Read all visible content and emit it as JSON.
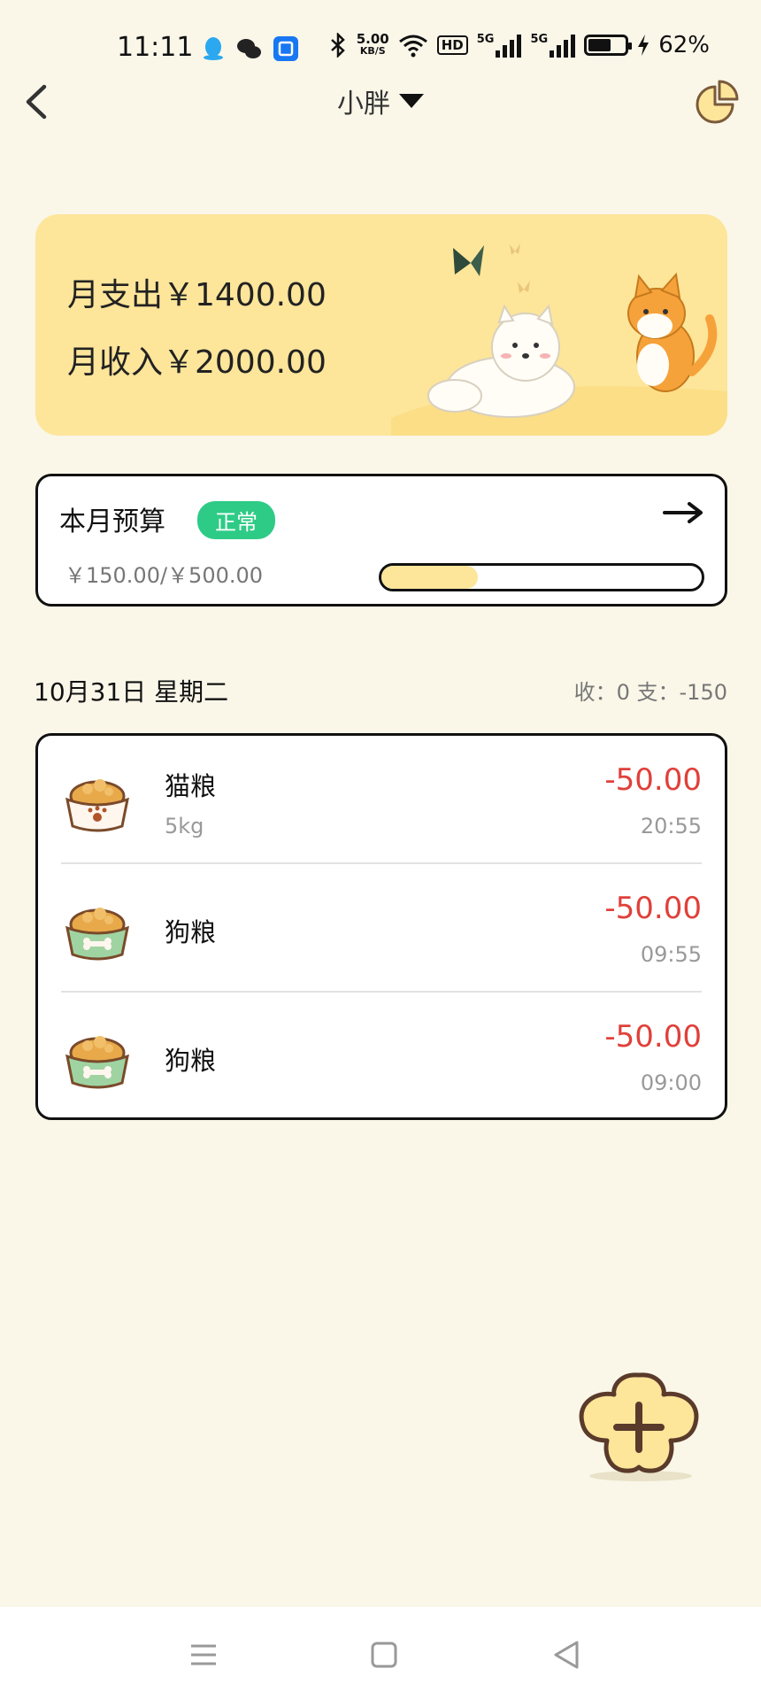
{
  "status_bar": {
    "time": "11:11",
    "net_speed": "5.00",
    "net_unit": "KB/S",
    "hd": "HD",
    "signal1": "5G",
    "signal2": "5G",
    "battery": "62%",
    "battery_level": 0.62
  },
  "header": {
    "title": "小胖"
  },
  "summary": {
    "expense_line": "月支出￥1400.00",
    "income_line": "月收入￥2000.00"
  },
  "budget": {
    "title": "本月预算",
    "status": "正常",
    "amount": "￥150.00/￥500.00",
    "progress": 0.3
  },
  "day": {
    "date": "10月31日 星期二",
    "summary": "收：0 支：-150"
  },
  "records": [
    {
      "name": "猫粮",
      "note": "5kg",
      "amount": "-50.00",
      "time": "20:55",
      "icon": "cat-food-bowl-icon"
    },
    {
      "name": "狗粮",
      "note": "",
      "amount": "-50.00",
      "time": "09:55",
      "icon": "dog-food-bowl-icon"
    },
    {
      "name": "狗粮",
      "note": "",
      "amount": "-50.00",
      "time": "09:00",
      "icon": "dog-food-bowl-icon"
    }
  ],
  "colors": {
    "background": "#faf7e9",
    "summary_card": "#fde59a",
    "badge_green": "#2ecb86",
    "expense_red": "#e0403a"
  }
}
